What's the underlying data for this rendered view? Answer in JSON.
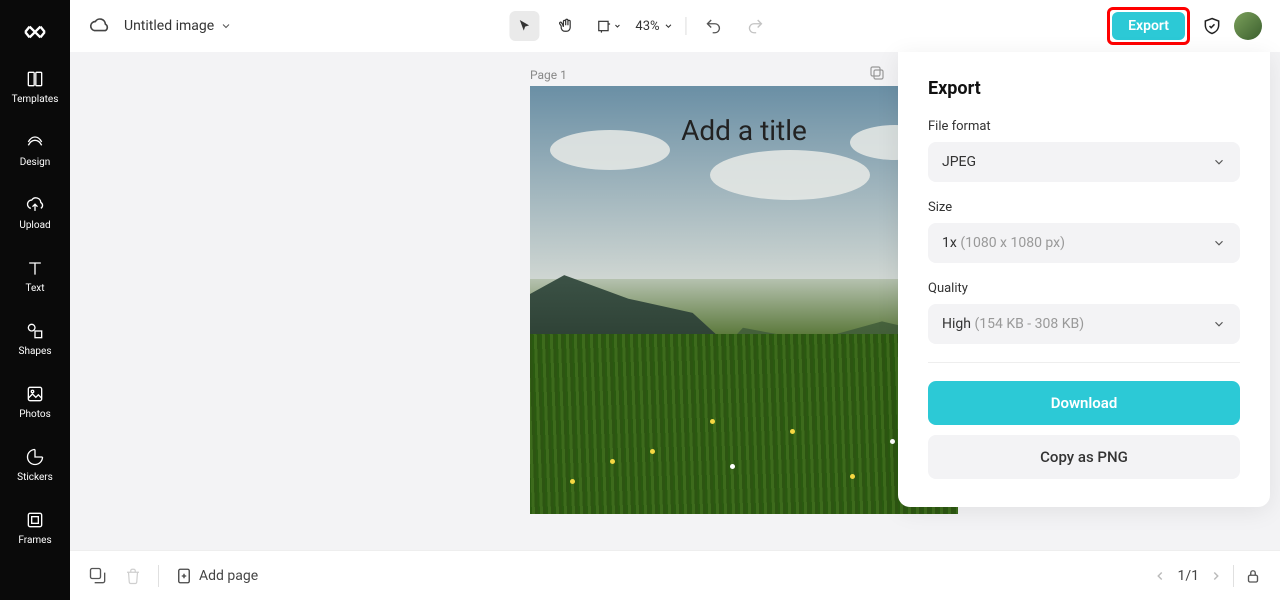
{
  "header": {
    "doc_title": "Untitled image",
    "zoom": "43%",
    "export_label": "Export"
  },
  "sidebar": {
    "items": [
      {
        "label": "Templates"
      },
      {
        "label": "Design"
      },
      {
        "label": "Upload"
      },
      {
        "label": "Text"
      },
      {
        "label": "Shapes"
      },
      {
        "label": "Photos"
      },
      {
        "label": "Stickers"
      },
      {
        "label": "Frames"
      }
    ]
  },
  "canvas": {
    "page_label": "Page 1",
    "title_placeholder": "Add a title"
  },
  "export_panel": {
    "heading": "Export",
    "file_format_label": "File format",
    "file_format_value": "JPEG",
    "size_label": "Size",
    "size_value": "1x",
    "size_detail": "(1080 x 1080 px)",
    "quality_label": "Quality",
    "quality_value": "High",
    "quality_detail": "(154 KB - 308 KB)",
    "download_label": "Download",
    "copy_label": "Copy as PNG"
  },
  "bottombar": {
    "add_page_label": "Add page",
    "page_indicator": "1/1"
  }
}
